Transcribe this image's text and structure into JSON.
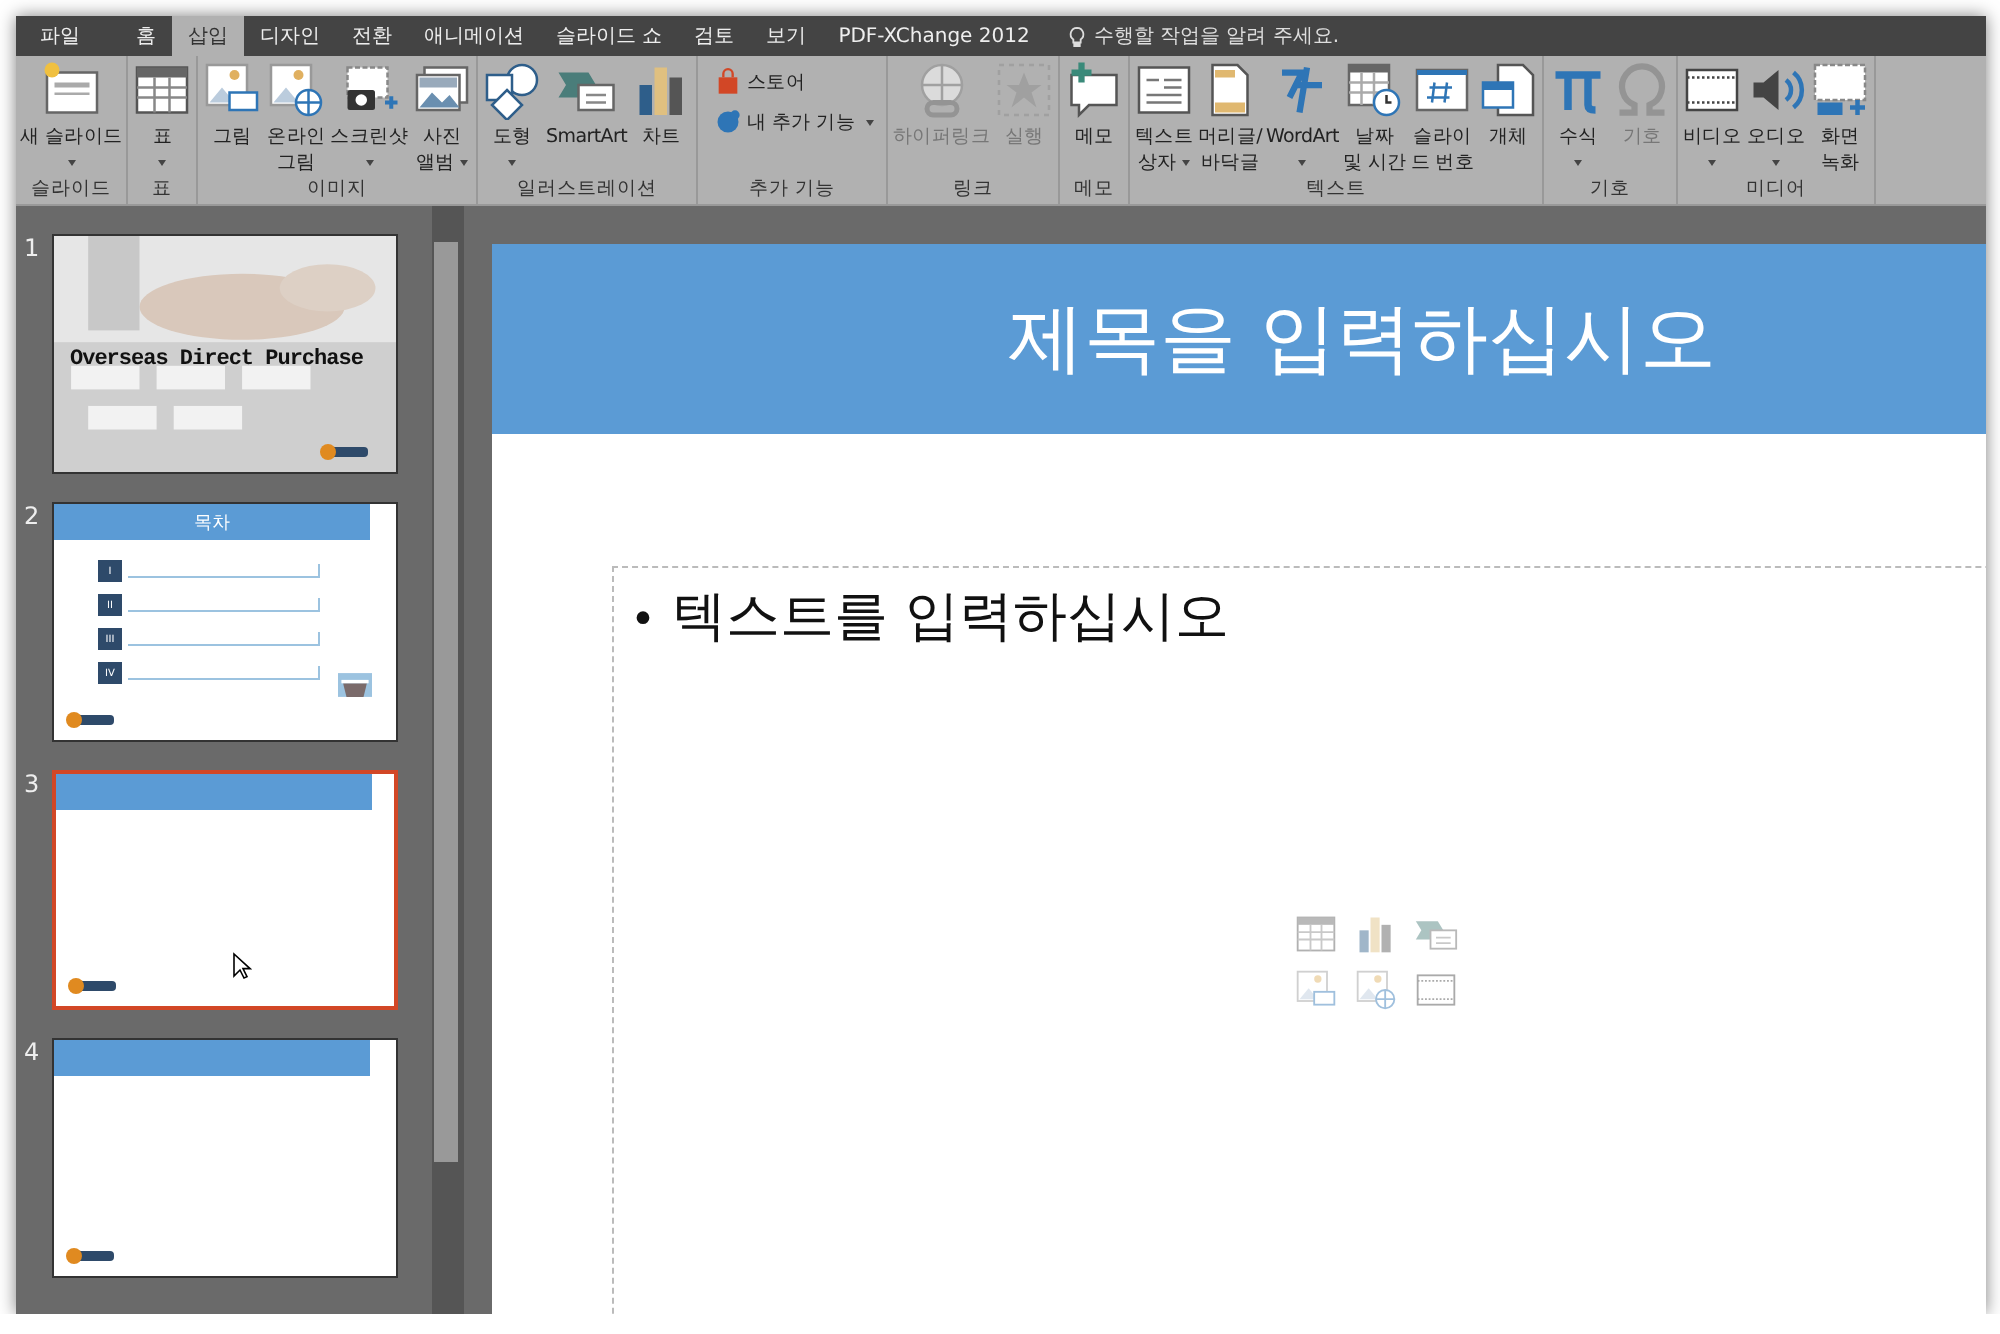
{
  "tabs": [
    {
      "label": "파일",
      "selected": false
    },
    {
      "label": "홈",
      "selected": false
    },
    {
      "label": "삽입",
      "selected": true
    },
    {
      "label": "디자인",
      "selected": false
    },
    {
      "label": "전환",
      "selected": false
    },
    {
      "label": "애니메이션",
      "selected": false
    },
    {
      "label": "슬라이드 쇼",
      "selected": false
    },
    {
      "label": "검토",
      "selected": false
    },
    {
      "label": "보기",
      "selected": false
    },
    {
      "label": "PDF-XChange 2012",
      "selected": false
    }
  ],
  "search": {
    "placeholder": "수행할 작업을 알려 주세요."
  },
  "ribbon": {
    "groups": [
      {
        "label": "슬라이드",
        "buttons": [
          {
            "kind": "newslide",
            "lines": [
              "새 슬라이드"
            ],
            "dropdown": true,
            "disabled": false
          }
        ]
      },
      {
        "label": "표",
        "buttons": [
          {
            "kind": "table",
            "lines": [
              "표"
            ],
            "dropdown": true,
            "disabled": false
          }
        ]
      },
      {
        "label": "이미지",
        "buttons": [
          {
            "kind": "picture",
            "lines": [
              "그림"
            ],
            "dropdown": false,
            "disabled": false
          },
          {
            "kind": "online",
            "lines": [
              "온라인",
              "그림"
            ],
            "dropdown": false,
            "disabled": false
          },
          {
            "kind": "screenshot",
            "lines": [
              "스크린샷"
            ],
            "dropdown": true,
            "disabled": false
          },
          {
            "kind": "album",
            "lines": [
              "사진",
              "앨범"
            ],
            "dropdown": true,
            "disabled": false
          }
        ]
      },
      {
        "label": "일러스트레이션",
        "buttons": [
          {
            "kind": "shapes",
            "lines": [
              "도형"
            ],
            "dropdown": true,
            "disabled": false
          },
          {
            "kind": "smartart",
            "lines": [
              "SmartArt"
            ],
            "dropdown": false,
            "disabled": false
          },
          {
            "kind": "chart",
            "lines": [
              "차트"
            ],
            "dropdown": false,
            "disabled": false
          }
        ]
      },
      {
        "label": "추가 기능",
        "buttons": [
          {
            "kind": "store",
            "lines": [
              "스토어"
            ],
            "dropdown": false,
            "disabled": false,
            "small": true
          },
          {
            "kind": "addins",
            "lines": [
              "내 추가 기능"
            ],
            "dropdown": true,
            "disabled": false,
            "small": true
          }
        ]
      },
      {
        "label": "링크",
        "buttons": [
          {
            "kind": "hyperlink",
            "lines": [
              "하이퍼링크"
            ],
            "dropdown": false,
            "disabled": true
          },
          {
            "kind": "action",
            "lines": [
              "실행"
            ],
            "dropdown": false,
            "disabled": true
          }
        ]
      },
      {
        "label": "메모",
        "buttons": [
          {
            "kind": "comment",
            "lines": [
              "메모"
            ],
            "dropdown": false,
            "disabled": false
          }
        ]
      },
      {
        "label": "텍스트",
        "buttons": [
          {
            "kind": "textbox",
            "lines": [
              "텍스트",
              "상자"
            ],
            "dropdown": true,
            "disabled": false
          },
          {
            "kind": "header",
            "lines": [
              "머리글/",
              "바닥글"
            ],
            "dropdown": false,
            "disabled": false
          },
          {
            "kind": "wordart",
            "lines": [
              "WordArt"
            ],
            "dropdown": true,
            "disabled": false
          },
          {
            "kind": "datetime",
            "lines": [
              "날짜",
              "및 시간"
            ],
            "dropdown": false,
            "disabled": false
          },
          {
            "kind": "slidenum",
            "lines": [
              "슬라이",
              "드 번호"
            ],
            "dropdown": false,
            "disabled": false
          },
          {
            "kind": "object",
            "lines": [
              "개체"
            ],
            "dropdown": false,
            "disabled": false
          }
        ]
      },
      {
        "label": "기호",
        "buttons": [
          {
            "kind": "equation",
            "lines": [
              "수식"
            ],
            "dropdown": true,
            "disabled": false
          },
          {
            "kind": "symbol",
            "lines": [
              "기호"
            ],
            "dropdown": false,
            "disabled": true
          }
        ]
      },
      {
        "label": "미디어",
        "buttons": [
          {
            "kind": "video",
            "lines": [
              "비디오"
            ],
            "dropdown": true,
            "disabled": false
          },
          {
            "kind": "audio",
            "lines": [
              "오디오"
            ],
            "dropdown": true,
            "disabled": false
          },
          {
            "kind": "record",
            "lines": [
              "화면",
              "녹화"
            ],
            "dropdown": false,
            "disabled": false
          }
        ]
      }
    ]
  },
  "slides": [
    {
      "number": "1",
      "kind": "cover",
      "title": "Overseas Direct Purchase",
      "selected": false
    },
    {
      "number": "2",
      "kind": "contents",
      "title": "목차",
      "items": [
        "I",
        "II",
        "III",
        "IV"
      ],
      "selected": false
    },
    {
      "number": "3",
      "kind": "blank",
      "selected": true
    },
    {
      "number": "4",
      "kind": "blank",
      "selected": false
    }
  ],
  "slide": {
    "title": "제목을 입력하십시오",
    "bullet_mark": "•",
    "bullet": "텍스트를 입력하십시오"
  }
}
